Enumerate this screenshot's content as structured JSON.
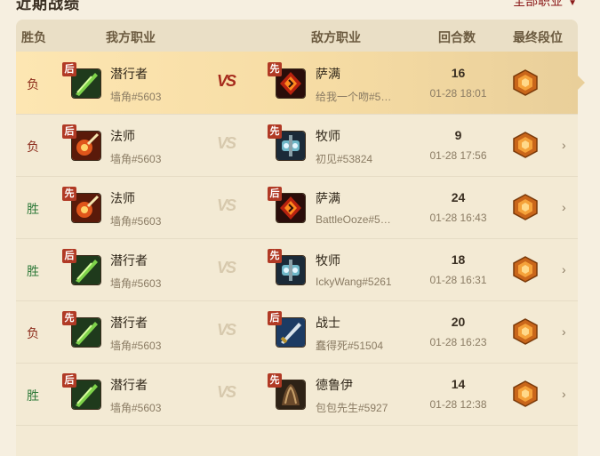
{
  "header": {
    "title": "近期战绩",
    "filter_label": "全部职业"
  },
  "columns": {
    "result": "胜负",
    "my_class": "我方职业",
    "enemy_class": "敌方职业",
    "rounds": "回合数",
    "rank": "最终段位"
  },
  "vs_label": "VS",
  "rows": [
    {
      "result": "负",
      "my_badge": "后",
      "my_class": "潜行者",
      "my_player": "墙角#5603",
      "enemy_badge": "先",
      "enemy_class": "萨满",
      "enemy_player": "给我一个吻#5…",
      "rounds": "16",
      "time": "01-28 18:01"
    },
    {
      "result": "负",
      "my_badge": "后",
      "my_class": "法师",
      "my_player": "墙角#5603",
      "enemy_badge": "先",
      "enemy_class": "牧师",
      "enemy_player": "初见#53824",
      "rounds": "9",
      "time": "01-28 17:56"
    },
    {
      "result": "胜",
      "my_badge": "先",
      "my_class": "法师",
      "my_player": "墙角#5603",
      "enemy_badge": "后",
      "enemy_class": "萨满",
      "enemy_player": "BattleOoze#5…",
      "rounds": "24",
      "time": "01-28 16:43"
    },
    {
      "result": "胜",
      "my_badge": "后",
      "my_class": "潜行者",
      "my_player": "墙角#5603",
      "enemy_badge": "先",
      "enemy_class": "牧师",
      "enemy_player": "IckyWang#5261",
      "rounds": "18",
      "time": "01-28 16:31"
    },
    {
      "result": "负",
      "my_badge": "先",
      "my_class": "潜行者",
      "my_player": "墙角#5603",
      "enemy_badge": "后",
      "enemy_class": "战士",
      "enemy_player": "蠢得死#51504",
      "rounds": "20",
      "time": "01-28 16:23"
    },
    {
      "result": "胜",
      "my_badge": "后",
      "my_class": "潜行者",
      "my_player": "墙角#5603",
      "enemy_badge": "先",
      "enemy_class": "德鲁伊",
      "enemy_player": "包包先生#5927",
      "rounds": "14",
      "time": "01-28 12:38"
    }
  ],
  "colors": {
    "lose": "#8b2a1a",
    "win": "#2f7a3a",
    "badge": "#b13a25",
    "accent": "#8b1a1a"
  }
}
